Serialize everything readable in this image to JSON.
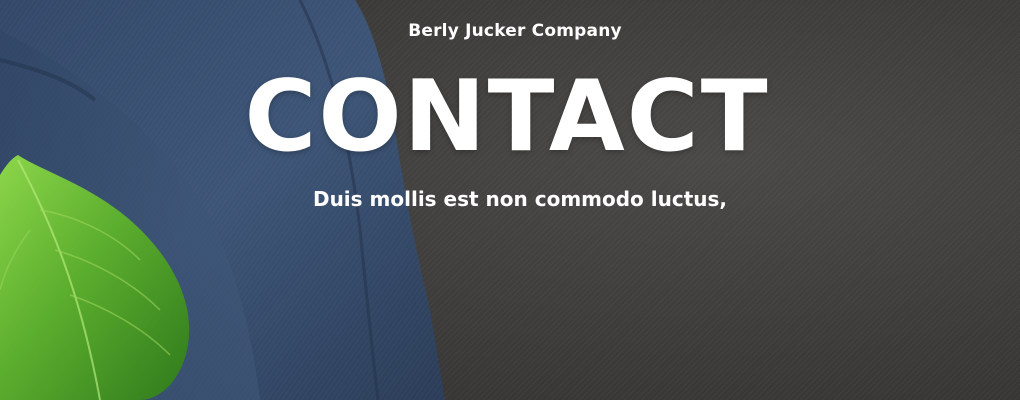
{
  "hero": {
    "company_name": "Berly Jucker Company",
    "title": "CONTACT",
    "subtitle": "Duis mollis est non commodo luctus,"
  },
  "colors": {
    "background": "#3f3e3c",
    "jacket": "#3a5070",
    "leaf": "#5aa830",
    "text": "#ffffff"
  },
  "icons": {
    "jacket_image": "suit-jacket-photo",
    "leaf_image": "green-leaf-photo"
  }
}
